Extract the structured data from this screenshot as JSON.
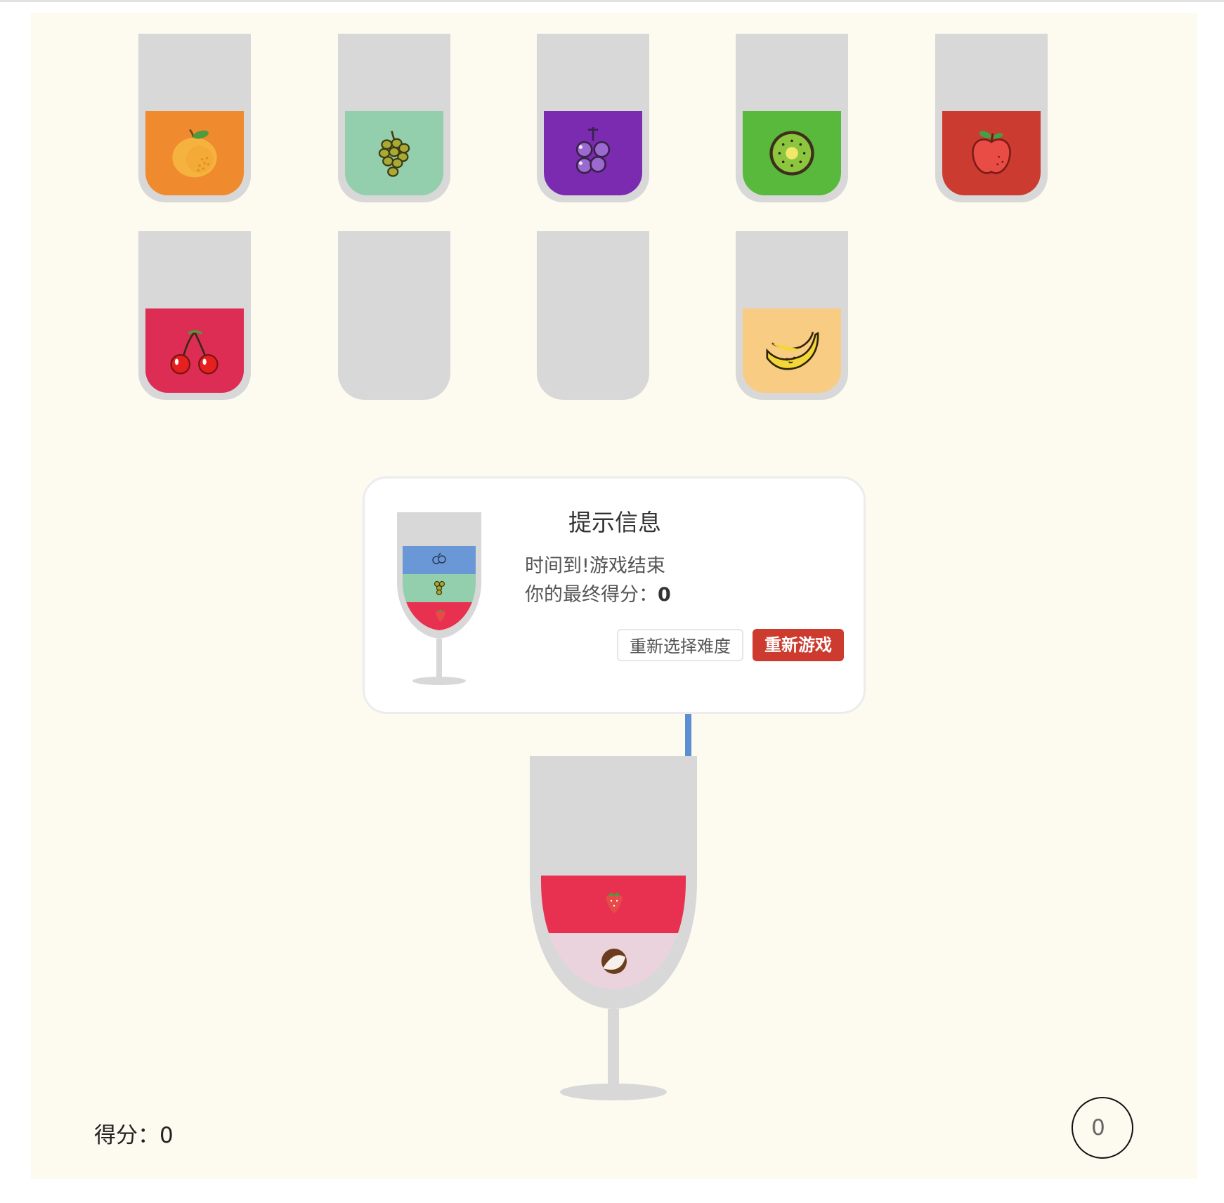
{
  "tubes": [
    {
      "fruit": "orange",
      "icon": "orange-icon",
      "color": "#f08a2f"
    },
    {
      "fruit": "green-grapes",
      "icon": "green-grapes-icon",
      "color": "#93cfac"
    },
    {
      "fruit": "grapes",
      "icon": "purple-grapes-icon",
      "color": "#7a2bb0"
    },
    {
      "fruit": "kiwi",
      "icon": "kiwi-icon",
      "color": "#58b93c"
    },
    {
      "fruit": "apple",
      "icon": "apple-icon",
      "color": "#cc3b30"
    },
    {
      "fruit": "cherry",
      "icon": "cherry-icon",
      "color": "#dd2d55"
    },
    {
      "fruit": "",
      "icon": "",
      "color": ""
    },
    {
      "fruit": "",
      "icon": "",
      "color": ""
    },
    {
      "fruit": "banana",
      "icon": "banana-icon",
      "color": "#f8cc82"
    }
  ],
  "dialog": {
    "title": "提示信息",
    "message": "时间到!游戏结束",
    "score_prefix": "你的最终得分：",
    "score_value": "0",
    "choose_difficulty_label": "重新选择难度",
    "restart_label": "重新游戏",
    "target_layers": [
      {
        "fruit": "blueberry",
        "color": "#6a98d6"
      },
      {
        "fruit": "green-grapes",
        "color": "#93cfac"
      },
      {
        "fruit": "strawberry",
        "color": "#e83151"
      }
    ]
  },
  "main_glass": {
    "layers": [
      {
        "fruit": "strawberry",
        "color": "#e83151"
      },
      {
        "fruit": "coconut",
        "color": "#ead3dc"
      }
    ],
    "straw_color": "#5b8fd1"
  },
  "score_label": "得分：",
  "score": "0",
  "timer": "0"
}
